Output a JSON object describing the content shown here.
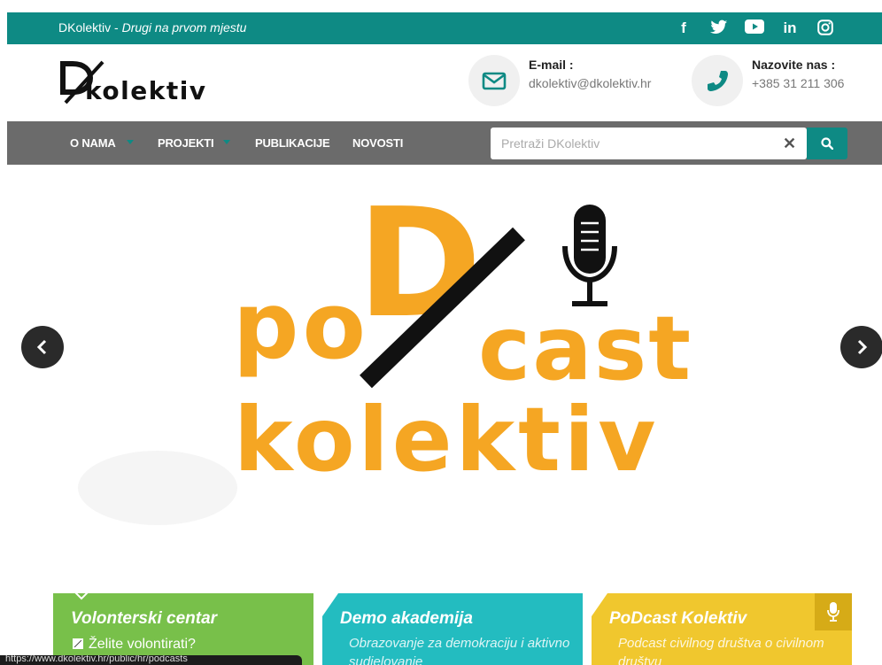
{
  "topbar": {
    "site_name": "DKolektiv - ",
    "slogan": "Drugi na prvom mjestu",
    "social": [
      {
        "icon": "facebook-icon",
        "glyph": "f"
      },
      {
        "icon": "twitter-icon",
        "glyph": ""
      },
      {
        "icon": "youtube-icon",
        "glyph": ""
      },
      {
        "icon": "linkedin-icon",
        "glyph": "in"
      },
      {
        "icon": "instagram-icon",
        "glyph": ""
      }
    ]
  },
  "header": {
    "logo_text": "kolektiv",
    "email_label": "E-mail :",
    "email_value": "dkolektiv@dkolektiv.hr",
    "phone_label": "Nazovite nas :",
    "phone_value": "+385 31 211 306"
  },
  "nav": {
    "items": [
      "O NAMA",
      "PROJEKTI",
      "PUBLIKACIJE",
      "NOVOSTI"
    ],
    "search_placeholder": "Pretraži DKolektiv"
  },
  "slide": {
    "line1": "po",
    "big_letter": "D",
    "line2": "cast",
    "line3": "kolektiv"
  },
  "cards": [
    {
      "title": "Volonterski centar",
      "text": "Želite volontirati?"
    },
    {
      "title": "Demo akademija",
      "text": "Obrazovanje za demokraciju i aktivno sudjelovanje"
    },
    {
      "title": "PoDcast Kolektiv",
      "text": "Podcast civilnog društva o civilnom društvu"
    }
  ],
  "statusbar": {
    "url": "https://www.dkolektiv.hr/public/hr/podcasts"
  },
  "colors": {
    "teal": "#0e8a84",
    "orange": "#f5a623",
    "nav_gray": "#6b6b6b"
  }
}
